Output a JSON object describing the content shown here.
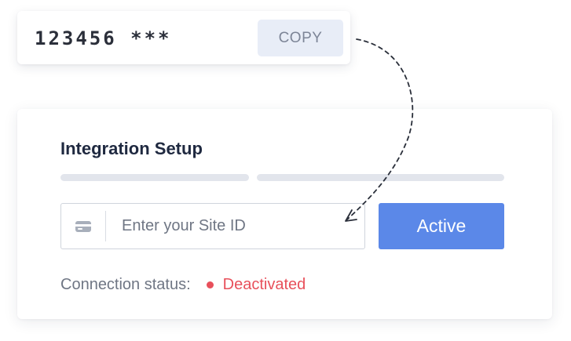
{
  "id_card": {
    "code": "123456 ***",
    "copy_label": "COPY"
  },
  "integration": {
    "title": "Integration Setup",
    "site_input": {
      "placeholder": "Enter your Site ID",
      "value": "",
      "icon": "id-card-icon"
    },
    "active_label": "Active",
    "status_label": "Connection status:",
    "status_value": "Deactivated"
  },
  "colors": {
    "accent": "#5b88e8",
    "status_error": "#e8505b",
    "copy_bg": "#e8edf7",
    "title": "#1f2940"
  }
}
